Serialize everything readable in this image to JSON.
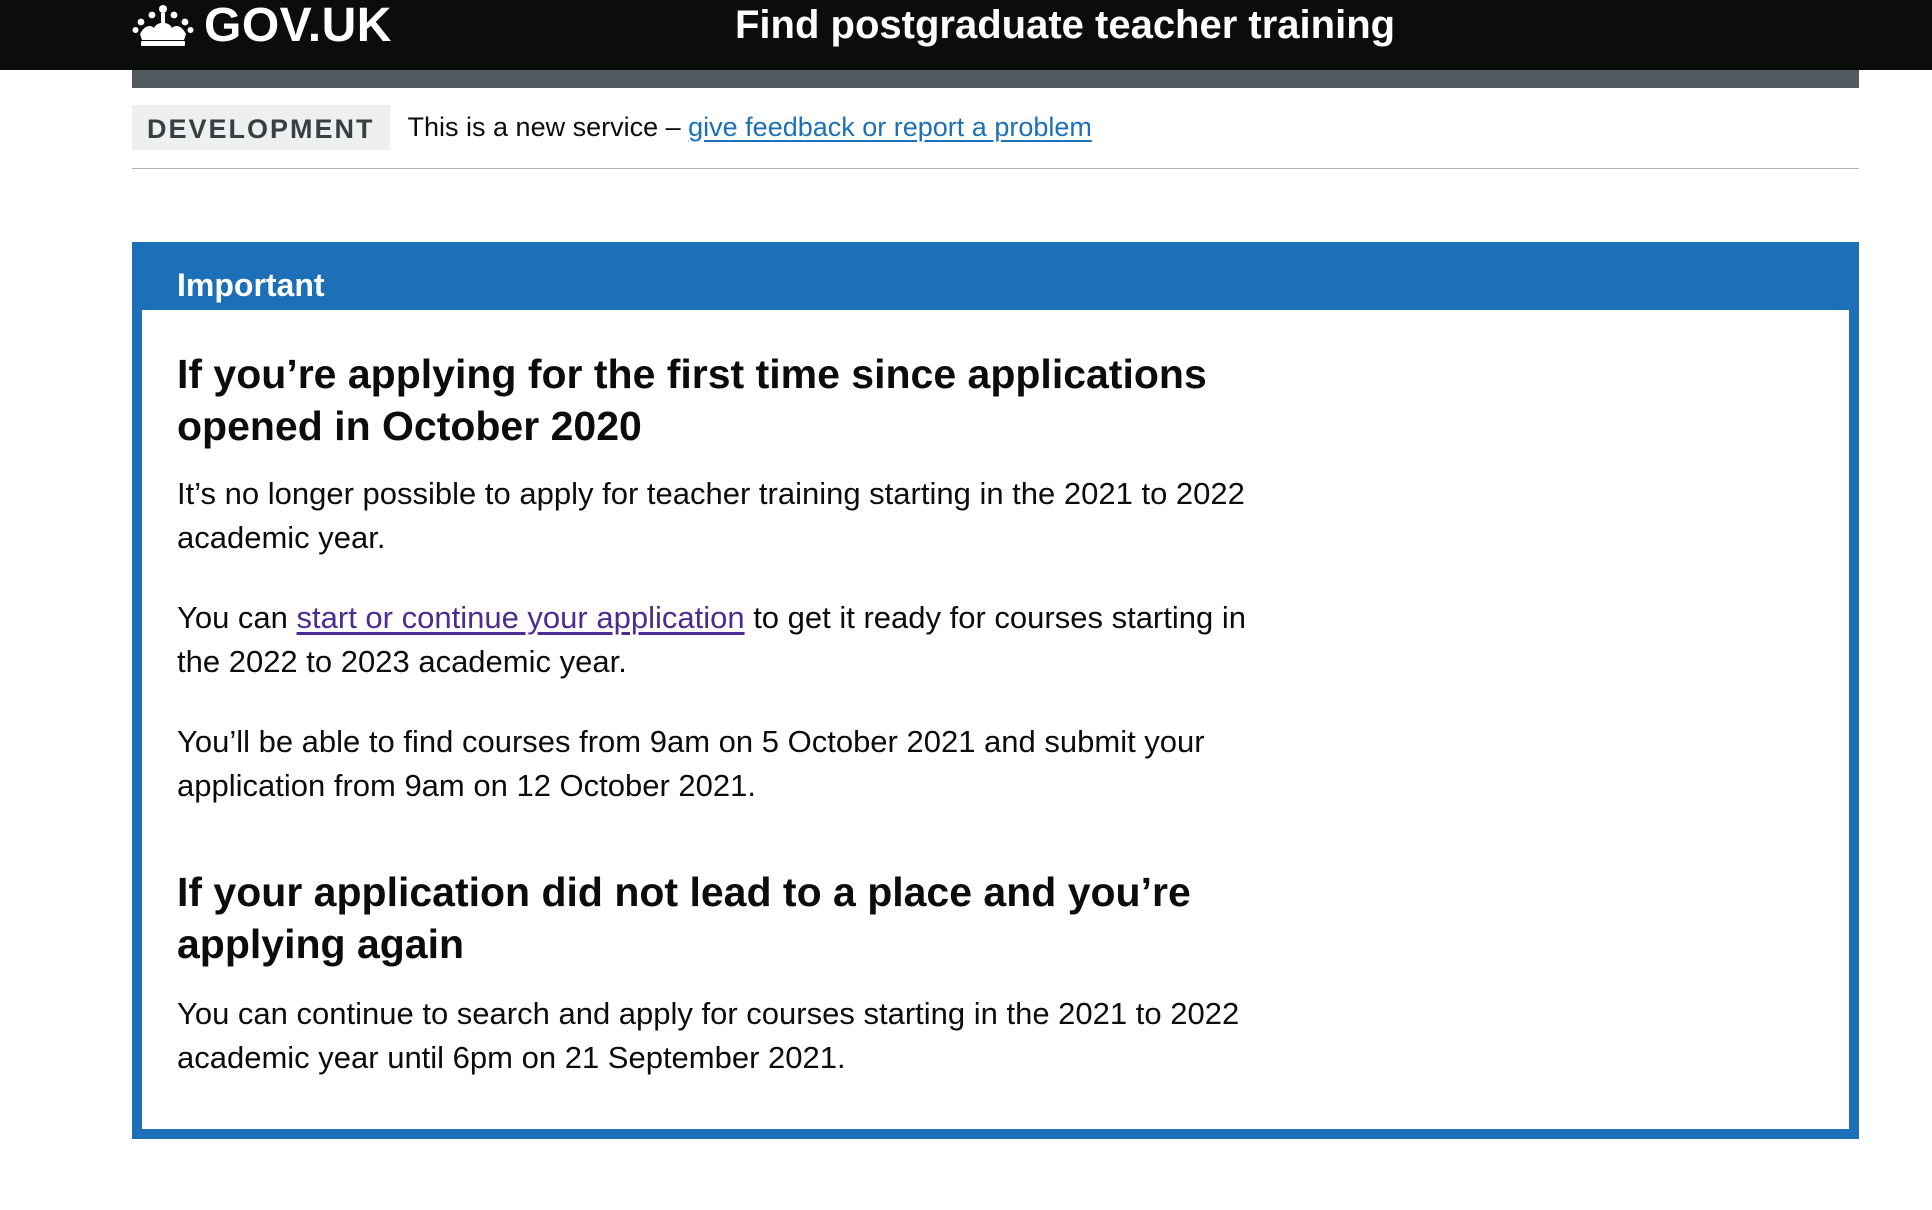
{
  "header": {
    "logo_text": "GOV.UK",
    "logo_icon": "crown-icon",
    "service_name": "Find postgraduate teacher training"
  },
  "phase_banner": {
    "tag": "DEVELOPMENT",
    "text": "This is a new service – ",
    "link_text": "give feedback or report a problem"
  },
  "notice": {
    "title": "Important",
    "heading_1": "If you’re applying for the first time since applications opened in October 2020",
    "para_1": "It’s no longer possible to apply for teacher training starting in the 2021 to 2022 academic year.",
    "para_2_prefix": "You can ",
    "para_2_link": "start or continue your application",
    "para_2_suffix": " to get it ready for courses starting in the 2022 to 2023 academic year.",
    "para_3": "You’ll be able to find courses from 9am on 5 October 2021 and submit your application from 9am on 12 October 2021.",
    "heading_2": "If your application did not lead to a place and you’re applying again",
    "para_4": "You can continue to search and apply for courses starting in the 2021 to 2022 academic year until 6pm on 21 September 2021."
  },
  "colors": {
    "header_bg": "#0b0c0c",
    "brand_blue": "#1d70b8",
    "link_visited": "#4c2c92",
    "header_bar": "#505a5f",
    "tag_bg": "#eeefef"
  }
}
